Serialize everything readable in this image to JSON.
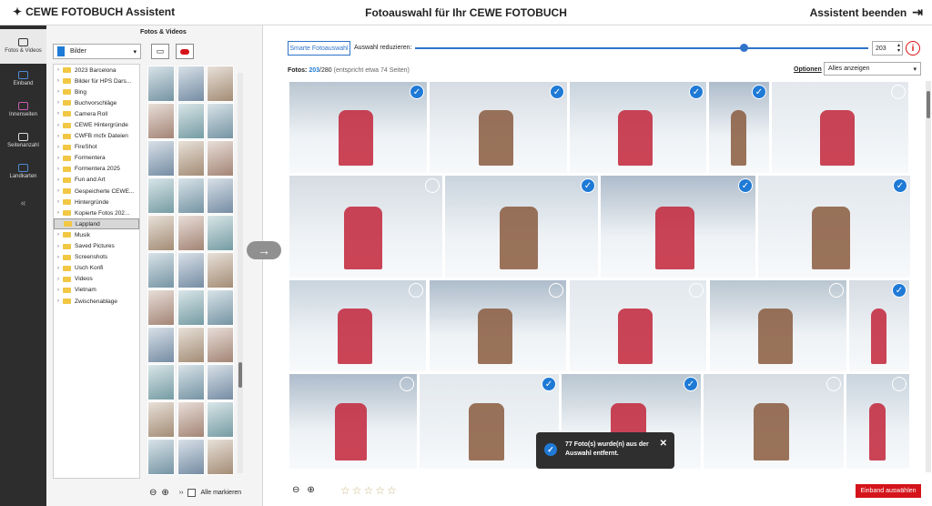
{
  "app": {
    "title": "CEWE FOTOBUCH Assistent",
    "page_title": "Fotoauswahl für Ihr CEWE FOTOBUCH",
    "exit_label": "Assistent beenden"
  },
  "sidebar": [
    {
      "label": "Fotos & Videos",
      "icon": "photos-icon",
      "active": true
    },
    {
      "label": "Einband",
      "icon": "cover-icon"
    },
    {
      "label": "Innenseiten",
      "icon": "pages-icon"
    },
    {
      "label": "Seitenanzahl",
      "icon": "pagecount-icon"
    },
    {
      "label": "Landkarten",
      "icon": "map-icon"
    },
    {
      "label": "«",
      "icon": "collapse-icon"
    }
  ],
  "left_panel": {
    "heading": "Fotos & Videos",
    "source_select": "Bilder",
    "folders": [
      "2023 Barcelona",
      "Bilder für HPS Dars...",
      "Bing",
      "Buchvorschläge",
      "Camera Roll",
      "CEWE Hintergründe",
      "CWFB mcfx Dateien",
      "FireShot",
      "Formentera",
      "Formentera 2025",
      "Fun and Art",
      "Gespeicherte CEWE...",
      "Hintergründe",
      "Kopierte Fotos 202...",
      "Lappland",
      "Musik",
      "Saved Pictures",
      "Screenshots",
      "Usch Konfi",
      "Videos",
      "Vietnam",
      "Zwischenablage"
    ],
    "selected_folder": "Lappland",
    "select_all_label": "Alle markieren"
  },
  "toolbar": {
    "smart_label": "Smarte Fotoauswahl",
    "reduce_label": "Auswahl reduzieren:",
    "reduce_value": "203",
    "fotos_prefix": "Fotos:",
    "fotos_selected": "203",
    "fotos_total": "/280",
    "fotos_hint": "(entspricht etwa 74 Seiten)",
    "options_label": "Optionen",
    "filter_select": "Alles anzeigen"
  },
  "toast": {
    "text": "77 Foto(s) wurde(n) aus der Auswahl entfernt."
  },
  "footer": {
    "einband_button": "Einband auswählen",
    "stars": "☆☆☆☆☆"
  },
  "colors": {
    "accent": "#1f7ad6",
    "brand_red": "#d4141a",
    "sidebar_bg": "#2d2d2d"
  }
}
